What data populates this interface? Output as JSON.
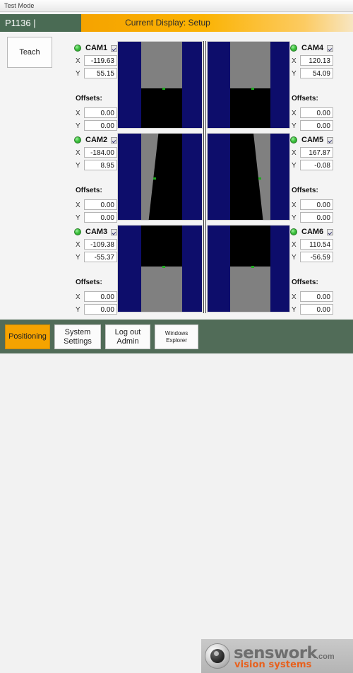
{
  "titlebar": {
    "text": "Test Mode"
  },
  "header": {
    "part_id": "P1136 |",
    "current_display": "Current Display: Setup"
  },
  "teach": {
    "label": "Teach"
  },
  "labels": {
    "x": "X",
    "y": "Y",
    "offsets": "Offsets:"
  },
  "cameras": [
    {
      "name": "CAM1",
      "status": "ok",
      "enabled": true,
      "x": "-119.63",
      "y": "55.15",
      "offset_x": "0.00",
      "offset_y": "0.00",
      "image": {
        "shape": "horizontal-split",
        "gray_on": "top",
        "split_pct": 53
      }
    },
    {
      "name": "CAM2",
      "status": "ok",
      "enabled": true,
      "x": "-184.00",
      "y": "8.95",
      "offset_x": "0.00",
      "offset_y": "0.00",
      "image": {
        "shape": "diagonal",
        "gray_on": "left",
        "split_pct": 40
      }
    },
    {
      "name": "CAM3",
      "status": "ok",
      "enabled": true,
      "x": "-109.38",
      "y": "-55.37",
      "offset_x": "0.00",
      "offset_y": "0.00",
      "image": {
        "shape": "horizontal-split",
        "gray_on": "bottom",
        "split_pct": 47
      }
    },
    {
      "name": "CAM4",
      "status": "ok",
      "enabled": true,
      "x": "120.13",
      "y": "54.09",
      "offset_x": "0.00",
      "offset_y": "0.00",
      "image": {
        "shape": "horizontal-split",
        "gray_on": "top",
        "split_pct": 53
      }
    },
    {
      "name": "CAM5",
      "status": "ok",
      "enabled": true,
      "x": "167.87",
      "y": "-0.08",
      "offset_x": "0.00",
      "offset_y": "0.00",
      "image": {
        "shape": "diagonal",
        "gray_on": "right",
        "split_pct": 40
      }
    },
    {
      "name": "CAM6",
      "status": "ok",
      "enabled": true,
      "x": "110.54",
      "y": "-56.59",
      "offset_x": "0.00",
      "offset_y": "0.00",
      "image": {
        "shape": "horizontal-split",
        "gray_on": "bottom",
        "split_pct": 47
      }
    }
  ],
  "toolbar": {
    "positioning": "Positioning",
    "system_settings": "System Settings",
    "log_out": "Log out Admin",
    "windows_explorer": "Windows Explorer",
    "active": "Positioning"
  },
  "logo": {
    "word": "senswork",
    "dotcom": ".com",
    "tagline": "vision systems"
  },
  "colors": {
    "header_green": "#4a6b54",
    "header_orange": "#f5a300",
    "bottom_bar": "#516c58",
    "led_green": "#3fc23f",
    "image_border_blue": "#0d0d6b",
    "image_gray": "#808080",
    "image_black": "#000000",
    "logo_orange": "#e8601c"
  }
}
